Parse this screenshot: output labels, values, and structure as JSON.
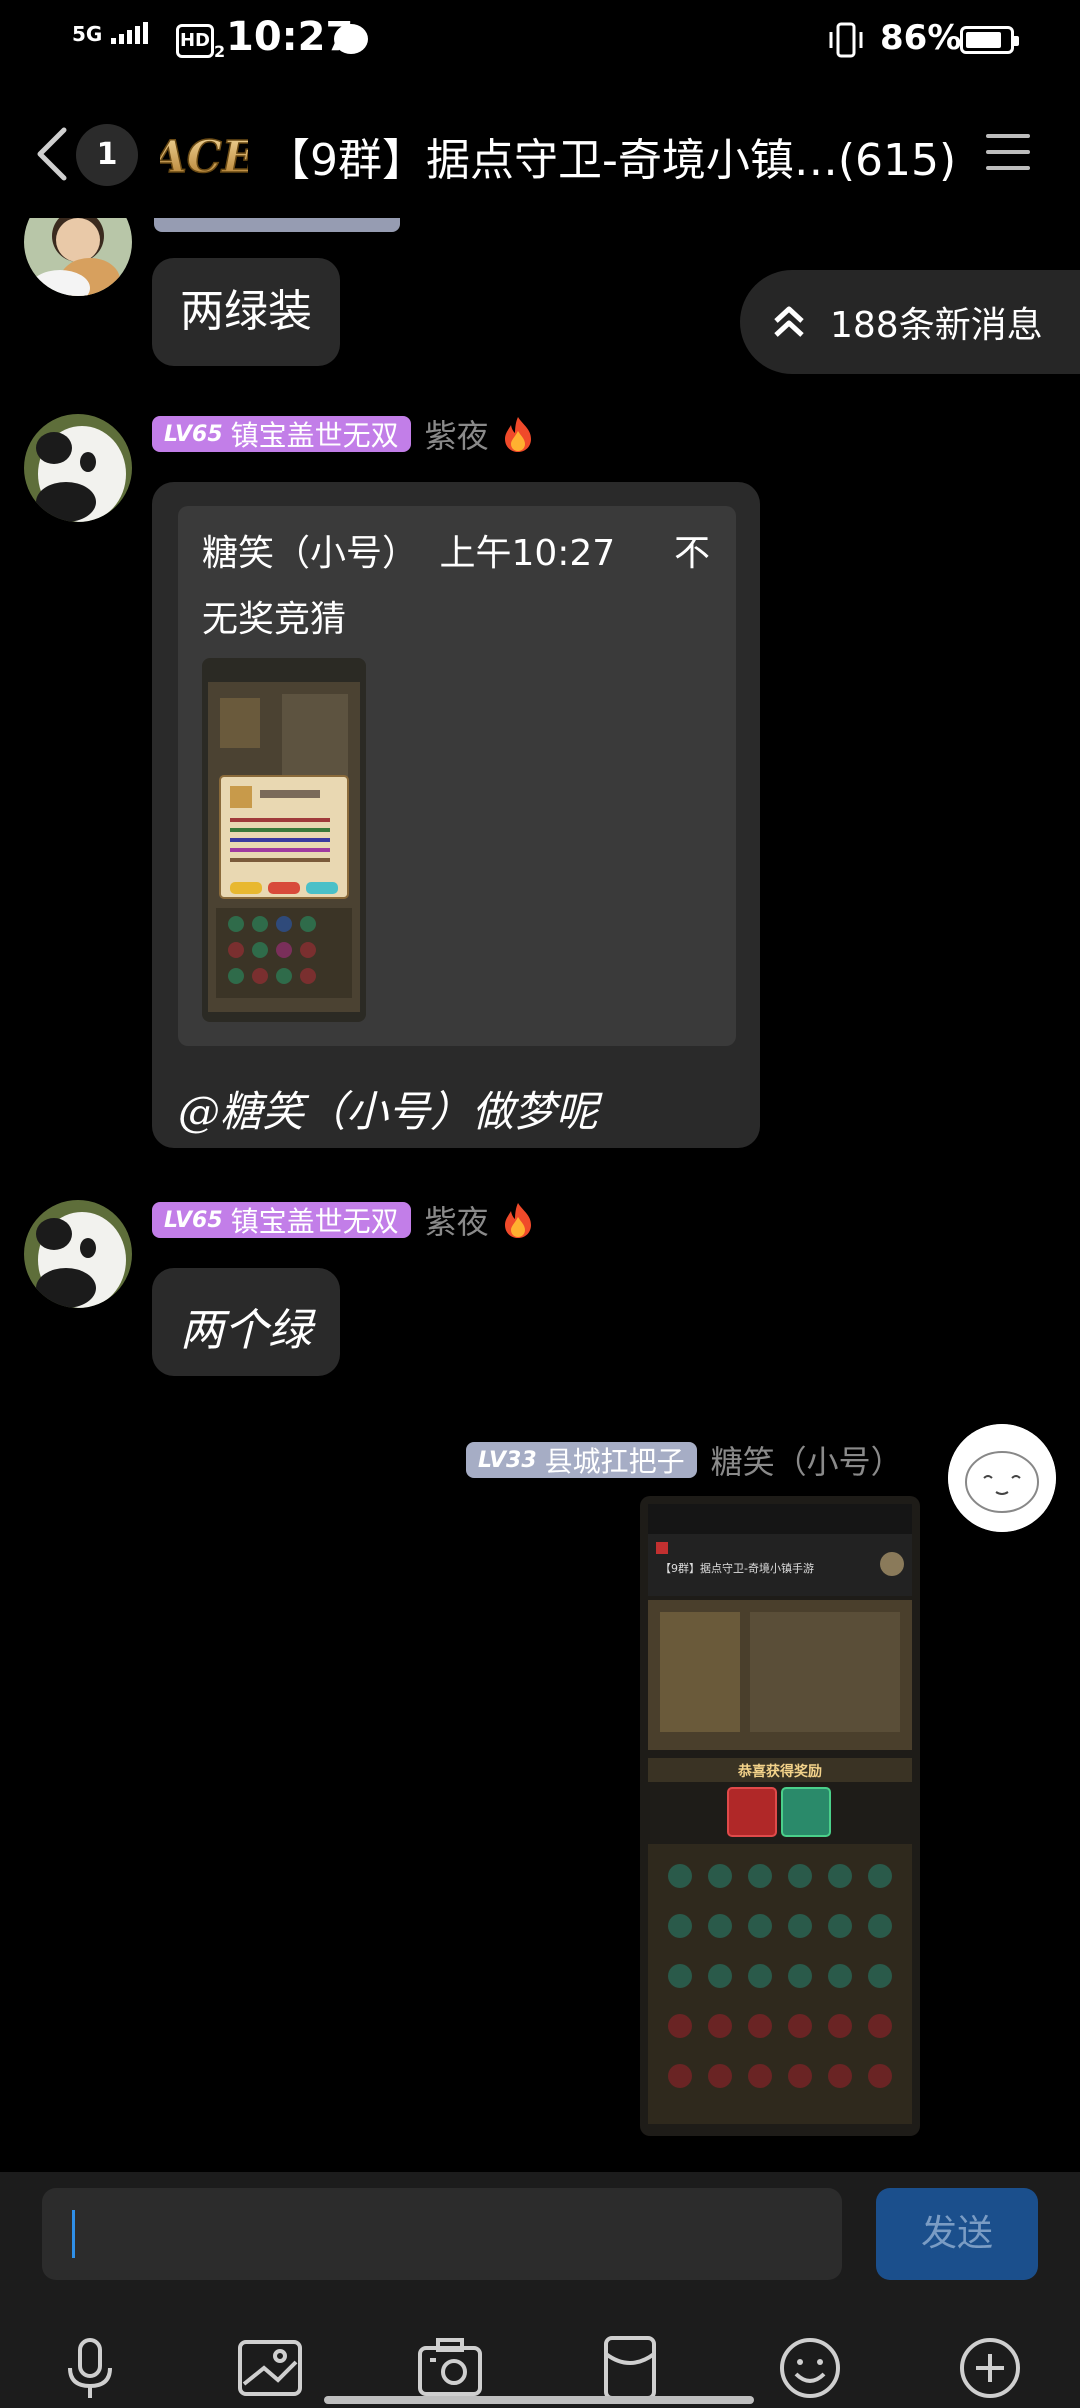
{
  "status_bar": {
    "signal": "5G",
    "hd": "HD",
    "hd_sub": "2",
    "time": "10:27",
    "battery_pct": "86%",
    "battery_level": 0.86
  },
  "header": {
    "unread_count": "1",
    "group_logo_text": "ACE",
    "title": "【9群】据点守卫-奇境小镇…(615)"
  },
  "new_messages_label": "188条新消息",
  "messages": [
    {
      "text": "两绿装"
    },
    {
      "level": "LV65",
      "title": "镇宝盖世无双",
      "name": "紫夜",
      "quote_author": "糖笑（小号）",
      "quote_time": "上午10:27",
      "quote_suffix": "不",
      "quote_text": "无奖竞猜",
      "text": "@糖笑（小号）做梦呢"
    },
    {
      "level": "LV65",
      "title": "镇宝盖世无双",
      "name": "紫夜",
      "text": "两个绿"
    },
    {
      "level": "LV33",
      "title": "县城扛把子",
      "name": "糖笑（小号）",
      "image_title": "【9群】据点守卫-奇境小镇手游",
      "image_banner": "恭喜获得奖励"
    }
  ],
  "input": {
    "placeholder": "",
    "send_label": "发送"
  },
  "toolbar": [
    "mic-icon",
    "image-icon",
    "camera-icon",
    "red-packet-icon",
    "emoji-icon",
    "plus-icon"
  ],
  "colors": {
    "accent": "#1b4f8c",
    "level_purple": "#c27ee8",
    "level_gray": "#a6adc5",
    "bubble": "#2a2a2a"
  }
}
